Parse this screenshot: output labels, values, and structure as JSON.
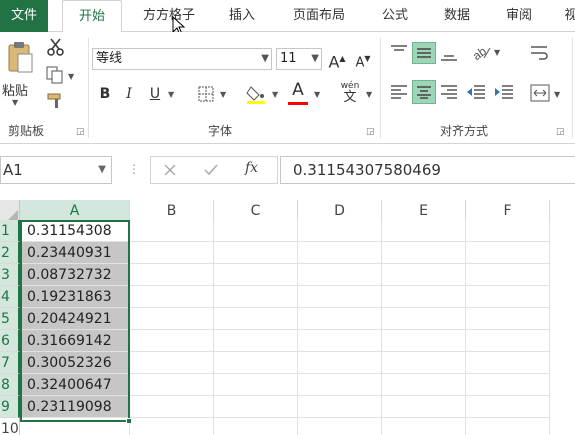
{
  "tabs": {
    "file": "文件",
    "home": "开始",
    "fangfang": "方方格子",
    "insert": "插入",
    "layout": "页面布局",
    "formulas": "公式",
    "data": "数据",
    "review": "审阅",
    "view_partial": "视"
  },
  "clipboard": {
    "paste": "粘贴",
    "group_label": "剪贴板"
  },
  "font": {
    "name": "等线",
    "size": "11",
    "bold": "B",
    "italic": "I",
    "underline": "U",
    "grow": "A",
    "shrink": "A",
    "color_letter": "A",
    "phonetic_top": "wén",
    "phonetic_bottom": "文",
    "group_label": "字体"
  },
  "alignment": {
    "group_label": "对齐方式"
  },
  "formula_bar": {
    "name_box": "A1",
    "fx": "fx",
    "formula": "0.31154307580469"
  },
  "grid": {
    "columns": [
      "A",
      "B",
      "C",
      "D",
      "E",
      "F"
    ],
    "rows": [
      "1",
      "2",
      "3",
      "4",
      "5",
      "6",
      "7",
      "8",
      "9",
      "10"
    ],
    "values": [
      "0.31154308",
      "0.23440931",
      "0.08732732",
      "0.19231863",
      "0.20424921",
      "0.31669142",
      "0.30052326",
      "0.32400647",
      "0.23119098"
    ]
  },
  "colors": {
    "accent": "#217346",
    "selected_fill": "#c6c6c6",
    "header_selected": "#d3e7dc"
  }
}
